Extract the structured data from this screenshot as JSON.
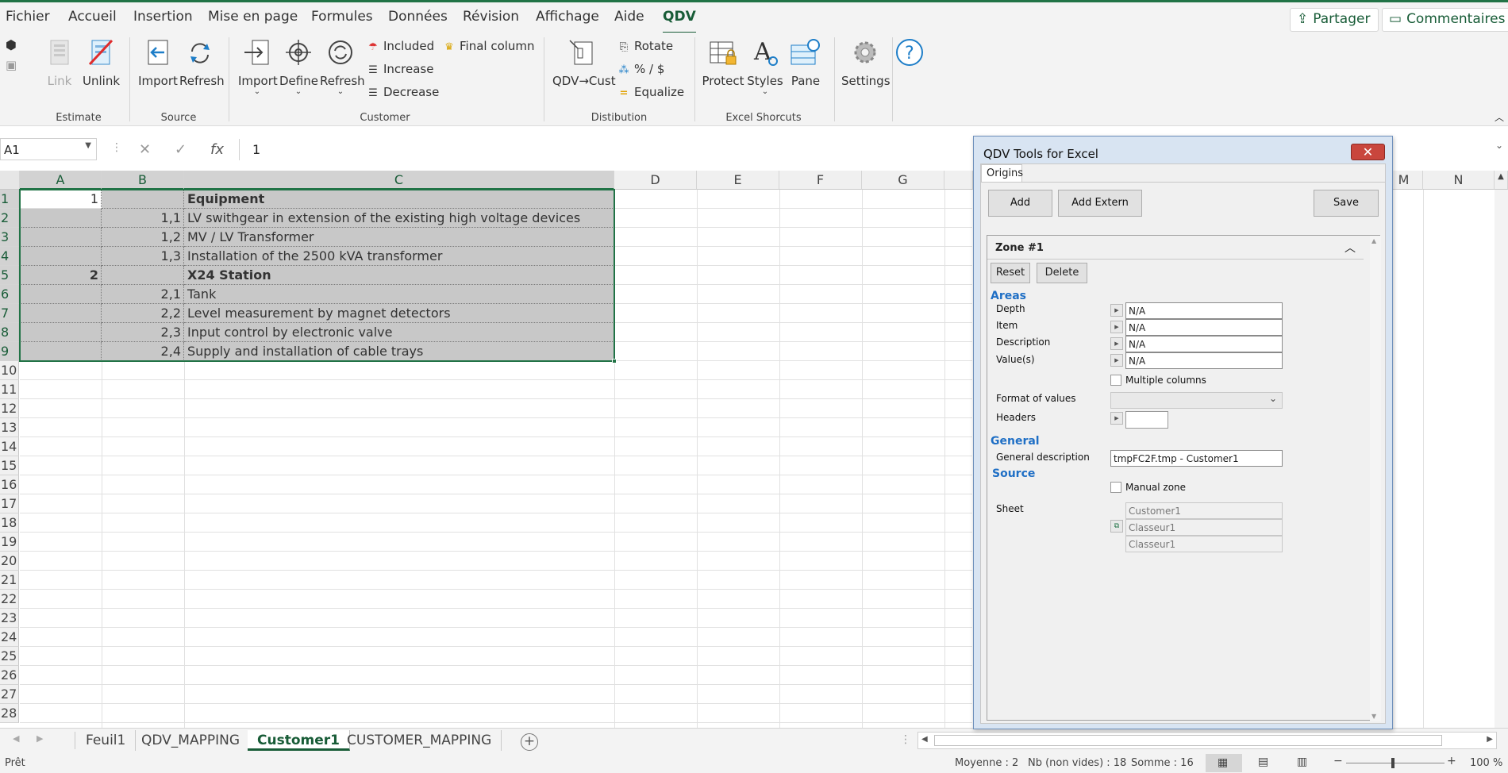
{
  "menu": {
    "tabs": [
      "Fichier",
      "Accueil",
      "Insertion",
      "Mise en page",
      "Formules",
      "Données",
      "Révision",
      "Affichage",
      "Aide",
      "QDV"
    ],
    "share_label": "Partager",
    "comments_label": "Commentaires"
  },
  "ribbon": {
    "groups": {
      "estimate": "Estimate",
      "source": "Source",
      "customer": "Customer",
      "distribution": "Distibution",
      "excel_shortcuts": "Excel Shorcuts"
    },
    "buttons": {
      "link": "Link",
      "unlink": "Unlink",
      "import_source": "Import",
      "refresh_source": "Refresh",
      "import_customer": "Import",
      "define": "Define",
      "refresh_customer": "Refresh",
      "included": "Included",
      "increase": "Increase",
      "decrease": "Decrease",
      "final_column": "Final column",
      "qdv_cust": "QDV→Cust",
      "rotate": "Rotate",
      "percent_dollar": "% / $",
      "equalize": "Equalize",
      "protect": "Protect",
      "styles": "Styles",
      "pane": "Pane",
      "settings": "Settings"
    }
  },
  "formula_bar": {
    "name_box": "A1",
    "formula": "1"
  },
  "grid": {
    "columns": [
      "A",
      "B",
      "C",
      "D",
      "E",
      "F",
      "G",
      "M",
      "N"
    ],
    "rows": [
      "1",
      "2",
      "3",
      "4",
      "5",
      "6",
      "7",
      "8",
      "9",
      "10",
      "11",
      "12",
      "13",
      "14",
      "15",
      "16",
      "17",
      "18",
      "19",
      "20",
      "21",
      "22",
      "23",
      "24",
      "25",
      "26",
      "27",
      "28"
    ],
    "data": [
      {
        "a": "1",
        "b": "",
        "c": "Equipment"
      },
      {
        "a": "",
        "b": "1,1",
        "c": "LV swithgear in extension of the existing high voltage devices"
      },
      {
        "a": "",
        "b": "1,2",
        "c": "MV / LV Transformer"
      },
      {
        "a": "",
        "b": "1,3",
        "c": "Installation of the 2500 kVA transformer"
      },
      {
        "a": "2",
        "b": "",
        "c": "X24 Station"
      },
      {
        "a": "",
        "b": "2,1",
        "c": "Tank"
      },
      {
        "a": "",
        "b": "2,2",
        "c": "Level measurement by magnet detectors"
      },
      {
        "a": "",
        "b": "2,3",
        "c": "Input control by electronic valve"
      },
      {
        "a": "",
        "b": "2,4",
        "c": "Supply and installation of cable trays"
      }
    ]
  },
  "sheet_tabs": [
    "Feuil1",
    "QDV_MAPPING",
    "Customer1",
    "CUSTOMER_MAPPING"
  ],
  "status_bar": {
    "ready": "Prêt",
    "average": "Moyenne : 2",
    "count": "Nb (non vides) : 18",
    "sum": "Somme : 16",
    "zoom": "100 %"
  },
  "dialog": {
    "title": "QDV Tools for Excel",
    "tab": "Origins",
    "add": "Add",
    "add_extern": "Add Extern",
    "save": "Save",
    "zone_title": "Zone #1",
    "reset": "Reset",
    "delete": "Delete",
    "areas_title": "Areas",
    "depth_label": "Depth",
    "depth_value": "N/A",
    "item_label": "Item",
    "item_value": "N/A",
    "description_label": "Description",
    "description_value": "N/A",
    "values_label": "Value(s)",
    "values_value": "N/A",
    "multiple_columns": "Multiple columns",
    "format_label": "Format of values",
    "headers_label": "Headers",
    "general_title": "General",
    "general_desc_label": "General description",
    "general_desc_value": "tmpFC2F.tmp - Customer1",
    "source_title": "Source",
    "manual_zone": "Manual zone",
    "sheet_label": "Sheet",
    "sheet_value": "Customer1",
    "workbook_value": "Classeur1",
    "workbook_value2": "Classeur1"
  }
}
